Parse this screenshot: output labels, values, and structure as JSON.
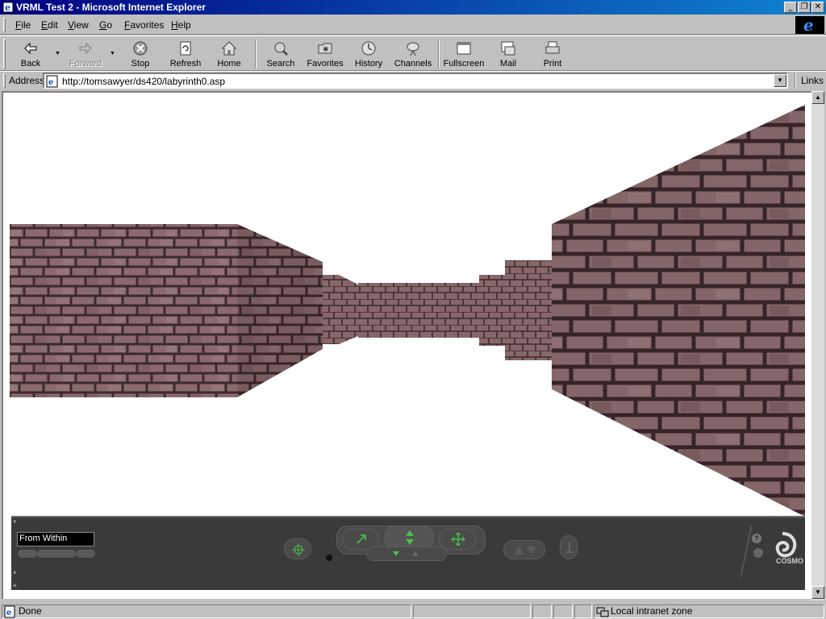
{
  "window": {
    "title": "VRML Test 2 - Microsoft Internet Explorer",
    "minimize_label": "_",
    "restore_label": "❐",
    "close_label": "✕"
  },
  "menu": {
    "items": [
      {
        "key": "F",
        "rest": "ile"
      },
      {
        "key": "E",
        "rest": "dit"
      },
      {
        "key": "V",
        "rest": "iew"
      },
      {
        "key": "G",
        "rest": "o"
      },
      {
        "key": "F",
        "rest": "avorites"
      },
      {
        "key": "H",
        "rest": "elp"
      }
    ]
  },
  "toolbar": {
    "back": "Back",
    "forward": "Forward",
    "stop": "Stop",
    "refresh": "Refresh",
    "home": "Home",
    "search": "Search",
    "favorites": "Favorites",
    "history": "History",
    "channels": "Channels",
    "fullscreen": "Fullscreen",
    "mail": "Mail",
    "print": "Print"
  },
  "address": {
    "label": "Address",
    "url": "http://tomsawyer/ds420/labyrinth0.asp",
    "links": "Links"
  },
  "player": {
    "viewpoint": "From Within",
    "brand": "COSMO",
    "help": "?"
  },
  "status": {
    "text": "Done",
    "zone": "Local intranet zone"
  },
  "colors": {
    "titlebar_start": "#000080",
    "titlebar_end": "#1084d0",
    "chrome": "#c0c0c0",
    "wall": "#8a6a6c",
    "wall_dark": "#4a3336",
    "console": "#3a3a3a"
  }
}
